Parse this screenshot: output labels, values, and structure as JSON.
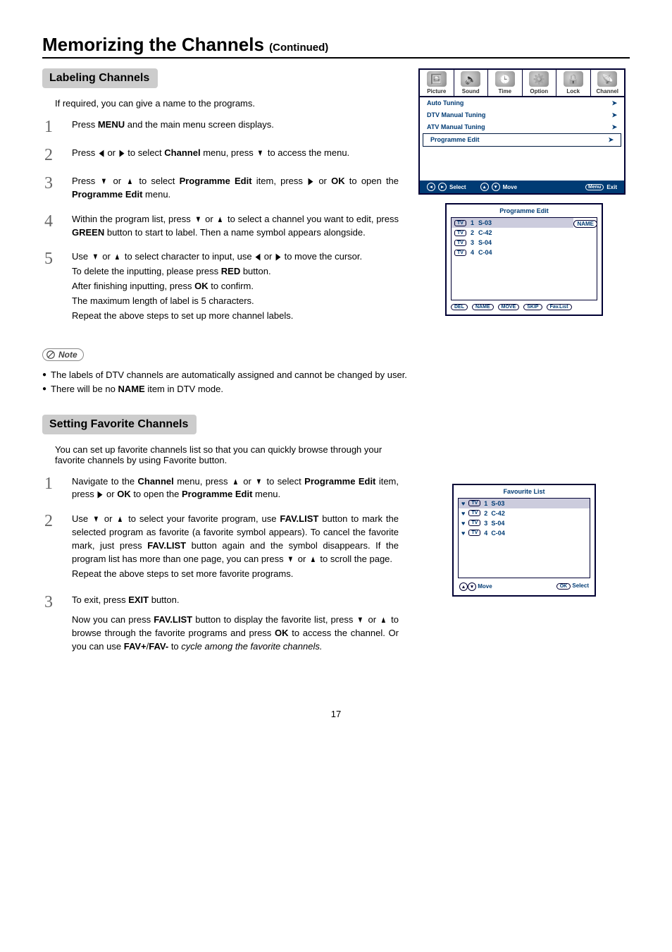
{
  "page": {
    "title": "Memorizing the Channels",
    "continued": "(Continued)",
    "number": "17"
  },
  "labeling": {
    "heading": "Labeling Channels",
    "intro": "If required, you can give a name to the programs.",
    "steps": {
      "1": "Press <b>MENU</b> and the main menu screen displays.",
      "2": "Press <span class='arrow'>◀</span> or <span class='arrow'>▶</span> to select <b>Channel</b> menu,  press <span class='arrow'>▼</span> to access the menu.",
      "3": "Press <span class='arrow'>▼</span> or <span class='arrow'>▲</span> to select <b>Programme Edit</b> item, press <span class='arrow'>▶</span> or <b>OK</b> to open the <b>Programme Edit</b> menu.",
      "4": "Within the program list,  press <span class='arrow'>▼</span> or <span class='arrow'>▲</span> to select a channel you want to edit, press <b>GREEN</b> button to start to label. Then a name symbol appears alongside.",
      "5": [
        "Use <span class='arrow'>▼</span> or <span class='arrow'>▲</span> to select character to input, use <span class='arrow'>◀</span> or <span class='arrow'>▶</span> to move the cursor.",
        "To delete the inputting, please press <b>RED</b> button.",
        "After finishing inputting, press <b>OK</b> to confirm.",
        "The maximum length of label is 5 characters.",
        "Repeat the above steps to set up more channel labels."
      ]
    },
    "note_label": "Note",
    "notes": [
      "The labels of DTV channels are automatically assigned and cannot be changed by user.",
      "There will be no <b>NAME</b> item in DTV mode."
    ]
  },
  "favorite": {
    "heading": "Setting Favorite Channels",
    "intro": "You can set up favorite channels list so that you can quickly browse through your favorite channels by using Favorite button.",
    "steps": {
      "1": "Navigate to the <b>Channel</b> menu,  press <span class='arrow'>▲</span> or <span class='arrow'>▼</span> to select <b>Programme Edit</b> item, press <span class='arrow'>▶</span> or <b>OK</b> to open the <b>Programme Edit</b> menu.",
      "2": [
        "Use <span class='arrow'>▼</span> or <span class='arrow'>▲</span> to select your favorite program, use <b>FAV.LIST</b> button to mark the selected program as favorite (a favorite symbol appears). To cancel the favorite mark, just press <b>FAV.LIST</b> button again and the symbol disappears. If the program list has more than one page, you can press <span class='arrow'>▼</span> or <span class='arrow'>▲</span> to scroll the page.",
        "Repeat the above steps to set more favorite programs."
      ],
      "3": [
        "To exit, press <b>EXIT</b> button.",
        "Now you can press <b>FAV.LIST</b> button to display the favorite list, press <span class='arrow'>▼</span> or <span class='arrow'>▲</span> to browse through the favorite programs and press <b>OK</b> to access the channel. Or you can use <b>FAV+</b>/<b>FAV-</b> to <span class='italic'>cycle among the favorite channels.</span>"
      ]
    }
  },
  "osd": {
    "tabs": [
      "Picture",
      "Sound",
      "Time",
      "Option",
      "Lock",
      "Channel"
    ],
    "rows": [
      {
        "label": "Auto Tuning",
        "sel": false
      },
      {
        "label": "DTV Manual Tuning",
        "sel": false
      },
      {
        "label": "ATV Manual Tuning",
        "sel": false
      },
      {
        "label": "Programme Edit",
        "sel": true
      }
    ],
    "footer": {
      "select": "Select",
      "move": "Move",
      "menu": "Menu",
      "exit": "Exit"
    }
  },
  "progEdit": {
    "title": "Programme Edit",
    "name_tag": "NAME",
    "rows": [
      {
        "idx": "1",
        "name": "S-03",
        "sel": true,
        "tag": "TV"
      },
      {
        "idx": "2",
        "name": "C-42",
        "sel": false,
        "tag": "TV"
      },
      {
        "idx": "3",
        "name": "S-04",
        "sel": false,
        "tag": "TV"
      },
      {
        "idx": "4",
        "name": "C-04",
        "sel": false,
        "tag": "TV"
      }
    ],
    "foot": [
      "DEL",
      "NAME",
      "MOVE",
      "SKIP",
      "Fav.List"
    ]
  },
  "favList": {
    "title": "Favourite List",
    "rows": [
      {
        "idx": "1",
        "name": "S-03",
        "sel": true,
        "tag": "TV"
      },
      {
        "idx": "2",
        "name": "C-42",
        "sel": false,
        "tag": "TV"
      },
      {
        "idx": "3",
        "name": "S-04",
        "sel": false,
        "tag": "TV"
      },
      {
        "idx": "4",
        "name": "C-04",
        "sel": false,
        "tag": "TV"
      }
    ],
    "foot": {
      "move": "Move",
      "ok": "OK",
      "select": "Select"
    }
  }
}
